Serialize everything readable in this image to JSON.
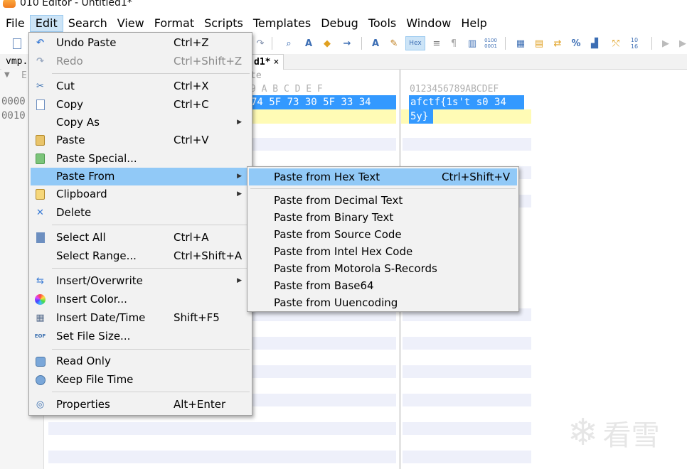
{
  "window": {
    "title": "010 Editor - Untitled1*"
  },
  "menubar": [
    "File",
    "Edit",
    "Search",
    "View",
    "Format",
    "Scripts",
    "Templates",
    "Debug",
    "Tools",
    "Window",
    "Help"
  ],
  "toolbar": {
    "hex_button": "Hex"
  },
  "tabs": {
    "inactive": "vmp.",
    "active": "d1*",
    "close": "×"
  },
  "editor": {
    "ruler_left": "E",
    "ruler_right": "te",
    "hex_header": "9  A  B  C  D  E  F",
    "text_header": "0123456789ABCDEF",
    "addresses": [
      "0000",
      "0010"
    ],
    "hex_row0": "74 5F 73 30 5F 33 34",
    "text_row0": "afctf{1s't s0 34",
    "text_row1": "5y}",
    "watermark": "看雪"
  },
  "edit_menu": [
    {
      "label": "Undo Paste",
      "shortcut": "Ctrl+Z",
      "icon": "undo-icon"
    },
    {
      "label": "Redo",
      "shortcut": "Ctrl+Shift+Z",
      "icon": "redo-icon",
      "disabled": true
    },
    {
      "label": "Cut",
      "shortcut": "Ctrl+X",
      "icon": "scissors-icon"
    },
    {
      "label": "Copy",
      "shortcut": "Ctrl+C",
      "icon": "copy-icon"
    },
    {
      "label": "Copy As",
      "shortcut": "",
      "icon": "",
      "submenu": true
    },
    {
      "label": "Paste",
      "shortcut": "Ctrl+V",
      "icon": "paste-icon"
    },
    {
      "label": "Paste Special...",
      "shortcut": "",
      "icon": "paste-special-icon"
    },
    {
      "label": "Paste From",
      "shortcut": "",
      "icon": "",
      "submenu": true,
      "highlighted": true
    },
    {
      "label": "Clipboard",
      "shortcut": "",
      "icon": "clipboard-icon",
      "submenu": true
    },
    {
      "label": "Delete",
      "shortcut": "",
      "icon": "delete-icon"
    },
    {
      "label": "Select All",
      "shortcut": "Ctrl+A",
      "icon": "select-all-icon"
    },
    {
      "label": "Select Range...",
      "shortcut": "Ctrl+Shift+A",
      "icon": ""
    },
    {
      "label": "Insert/Overwrite",
      "shortcut": "",
      "icon": "insert-overwrite-icon",
      "submenu": true
    },
    {
      "label": "Insert Color...",
      "shortcut": "",
      "icon": "color-wheel-icon"
    },
    {
      "label": "Insert Date/Time",
      "shortcut": "Shift+F5",
      "icon": "calendar-icon"
    },
    {
      "label": "Set File Size...",
      "shortcut": "",
      "icon": "eof-icon"
    },
    {
      "label": "Read Only",
      "shortcut": "",
      "icon": "lock-icon"
    },
    {
      "label": "Keep File Time",
      "shortcut": "",
      "icon": "clock-lock-icon"
    },
    {
      "label": "Properties",
      "shortcut": "Alt+Enter",
      "icon": "properties-icon"
    }
  ],
  "paste_from_menu": [
    {
      "label": "Paste from Hex Text",
      "shortcut": "Ctrl+Shift+V",
      "highlighted": true
    },
    {
      "label": "Paste from Decimal Text",
      "shortcut": ""
    },
    {
      "label": "Paste from Binary Text",
      "shortcut": ""
    },
    {
      "label": "Paste from Source Code",
      "shortcut": ""
    },
    {
      "label": "Paste from Intel Hex Code",
      "shortcut": ""
    },
    {
      "label": "Paste from Motorola S-Records",
      "shortcut": ""
    },
    {
      "label": "Paste from Base64",
      "shortcut": ""
    },
    {
      "label": "Paste from Uuencoding",
      "shortcut": ""
    }
  ]
}
